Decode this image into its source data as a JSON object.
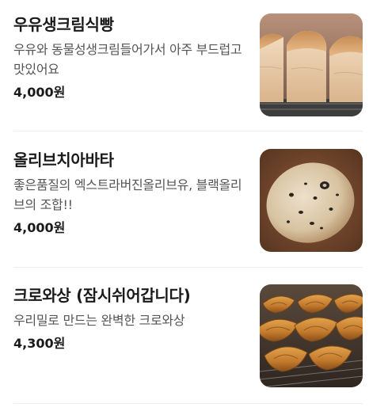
{
  "menu": {
    "items": [
      {
        "name": "우유생크림식빵",
        "description": "우유와 동물성생크림들어가서 아주 부드럽고 맛있어요",
        "price": "4,000원",
        "image": "milk-cream-bread-photo"
      },
      {
        "name": "올리브치아바타",
        "description": "좋은품질의 엑스트라버진올리브유, 블랙올리브의 조합!!",
        "price": "4,000원",
        "image": "olive-ciabatta-photo"
      },
      {
        "name": "크로와상 (잠시쉬어갑니다)",
        "description": "우리밀로 만드는 완벽한 크로와상",
        "price": "4,300원",
        "image": "croissant-photo"
      }
    ]
  }
}
